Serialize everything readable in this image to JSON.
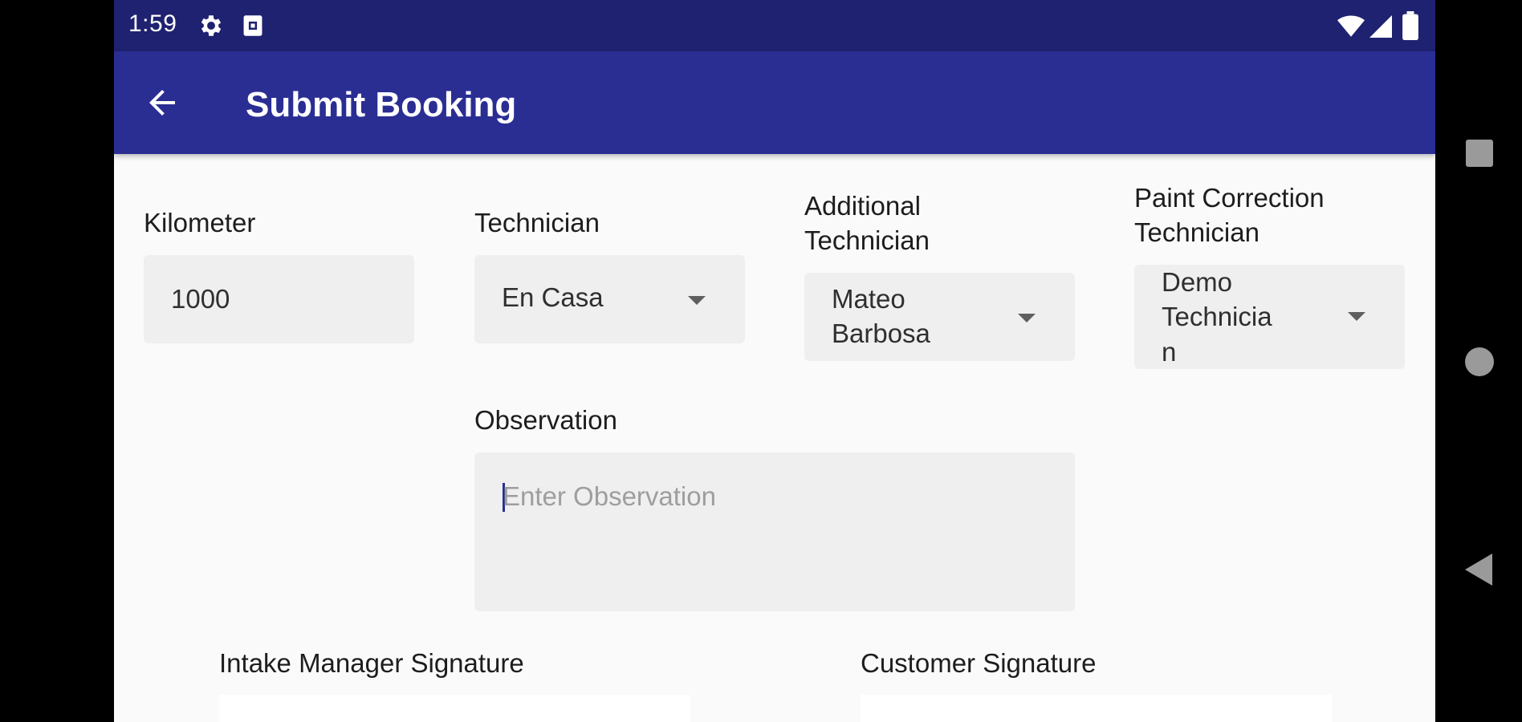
{
  "status_bar": {
    "time": "1:59",
    "icons": [
      "gear-icon",
      "sim-card-icon",
      "wifi-icon",
      "signal-icon",
      "battery-icon"
    ]
  },
  "app_bar": {
    "title": "Submit Booking",
    "back_icon": "arrow-back-icon",
    "color": "#2a2e93"
  },
  "form": {
    "kilometer": {
      "label": "Kilometer",
      "value": "1000"
    },
    "technician": {
      "label": "Technician",
      "value": "En Casa"
    },
    "additional_technician": {
      "label_line1": "Additional",
      "label_line2": "Technician",
      "value_line1": "Mateo",
      "value_line2": "Barbosa"
    },
    "paint_correction_technician": {
      "label_line1": "Paint Correction",
      "label_line2": "Technician",
      "value_line1": "Demo",
      "value_line2": "Technicia",
      "value_line3": "n"
    },
    "observation": {
      "label": "Observation",
      "placeholder": "Enter Observation"
    },
    "intake_manager_signature": {
      "label": "Intake Manager Signature"
    },
    "customer_signature": {
      "label": "Customer Signature"
    }
  },
  "nav_bar": {
    "icons": [
      "recents-icon",
      "home-icon",
      "back-icon"
    ]
  }
}
